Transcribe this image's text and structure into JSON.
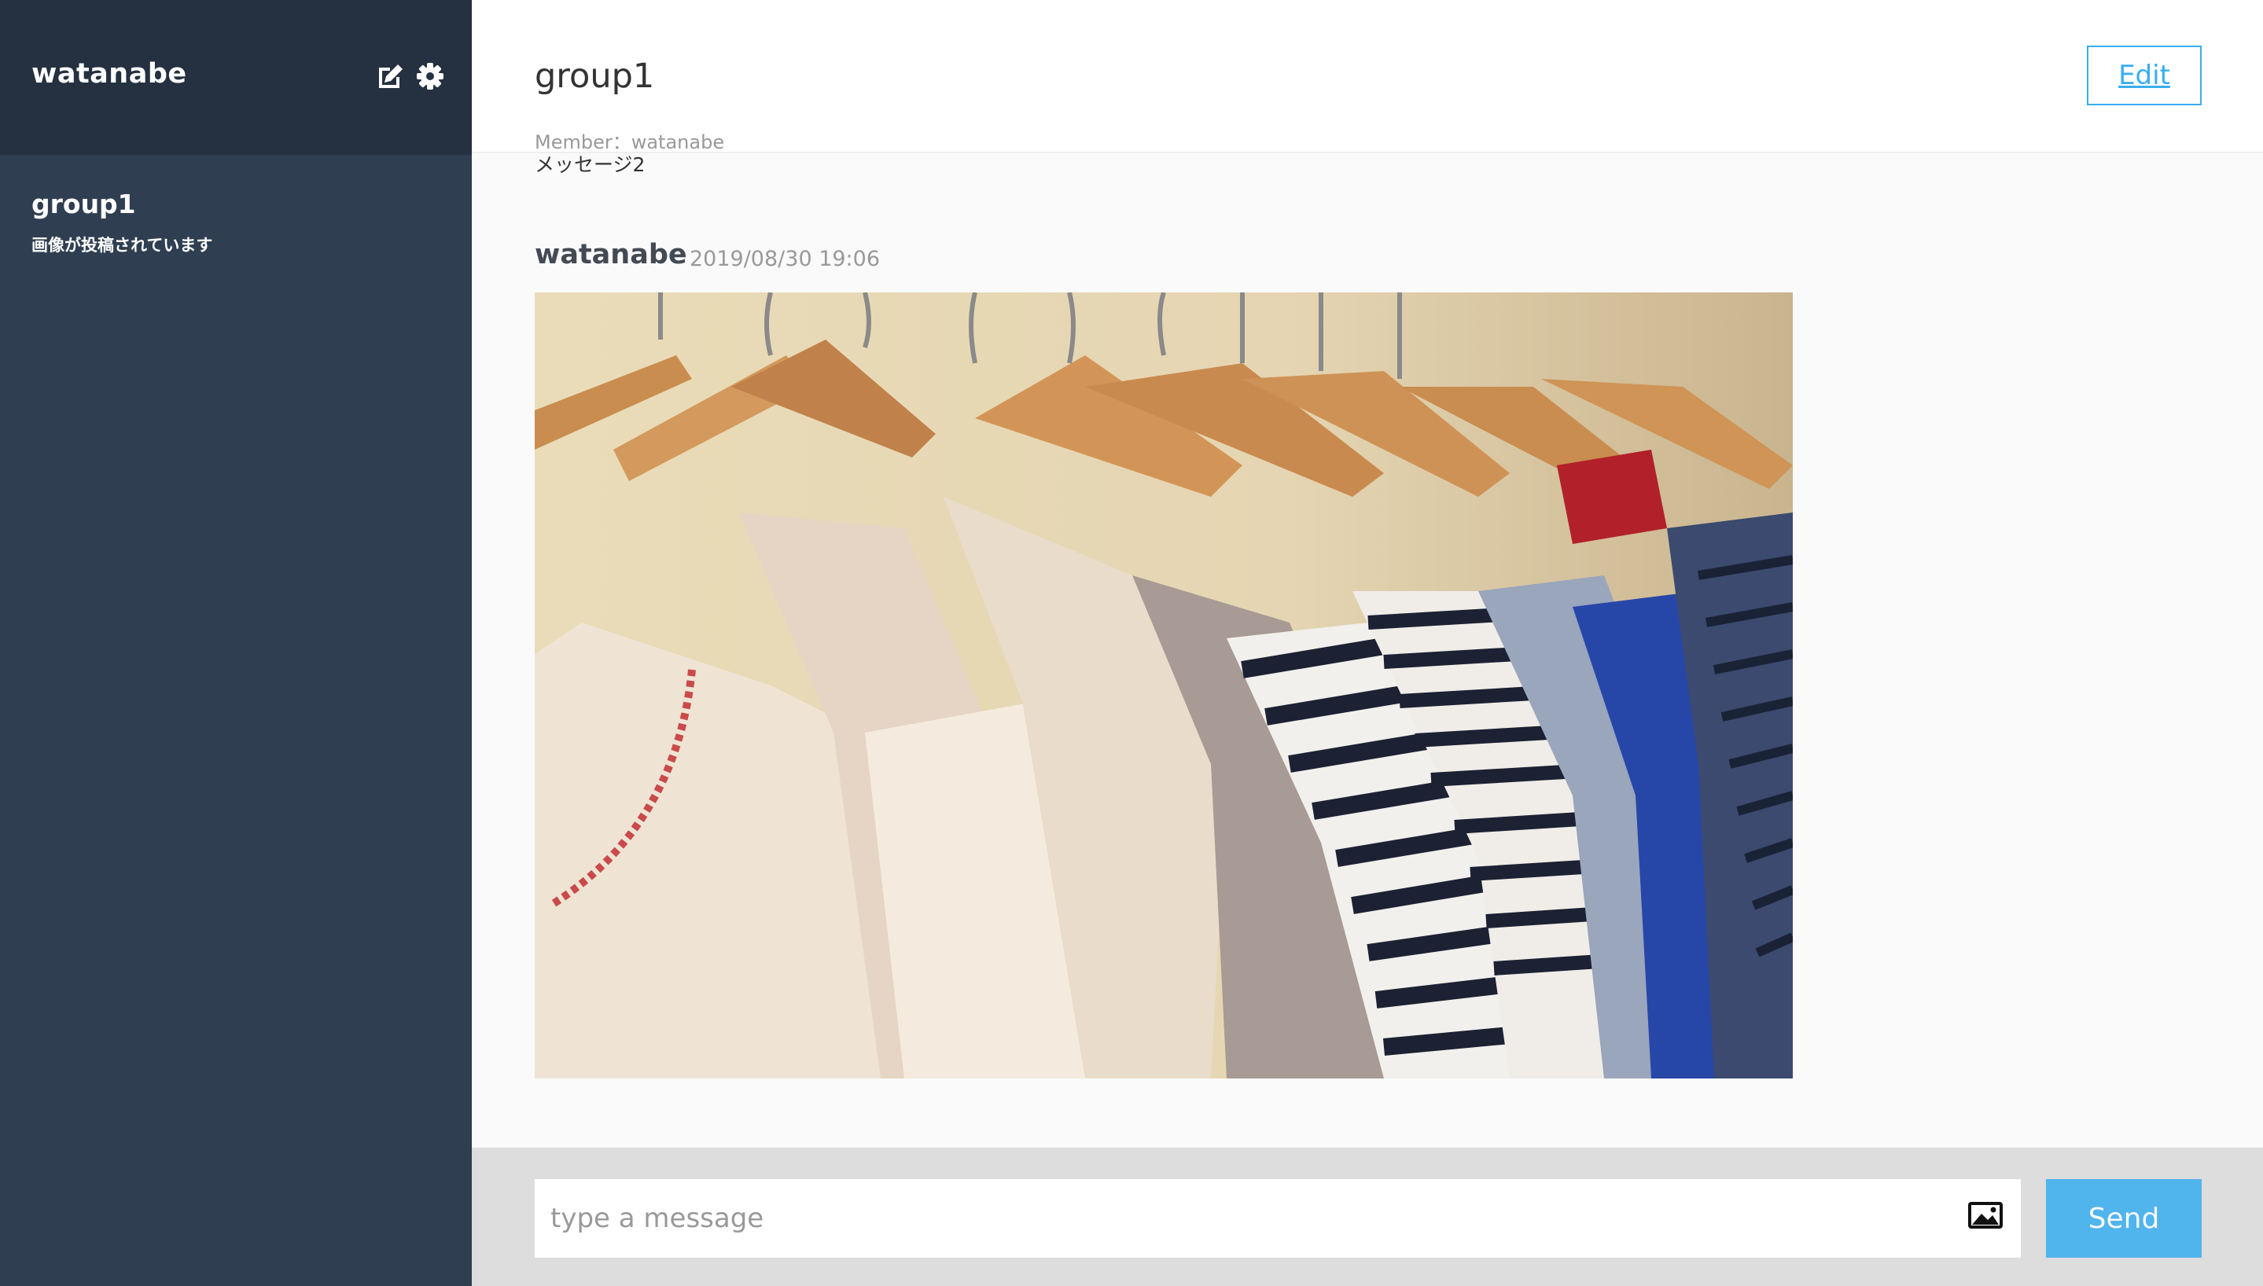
{
  "sidebar": {
    "user_name": "watanabe",
    "icons": [
      "edit-icon",
      "gear-icon"
    ],
    "groups": [
      {
        "name": "group1",
        "last_message": "画像が投稿されています"
      }
    ]
  },
  "header": {
    "group_name": "group1",
    "member_label": "Member：",
    "members": "watanabe",
    "edit_label": "Edit"
  },
  "messages": {
    "previous_text": "メッセージ2",
    "items": [
      {
        "user": "watanabe",
        "date": "2019/08/30 19:06",
        "image": "clothes-on-hangers-photo"
      }
    ]
  },
  "form": {
    "placeholder": "type a message",
    "image_icon": "image-icon",
    "send_label": "Send"
  },
  "colors": {
    "sidebar_bg": "#2f3e51",
    "sidebar_header_bg": "#253141",
    "accent": "#38aef0",
    "main_bg": "#fafafa",
    "footer_bg": "#dddddd"
  }
}
